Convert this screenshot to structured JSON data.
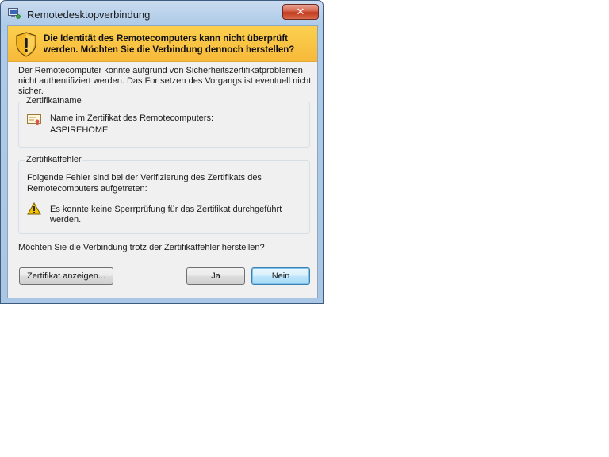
{
  "window": {
    "title": "Remotedesktopverbindung",
    "close_symbol": "✕",
    "icons": {
      "app": "remote-desktop-icon",
      "close": "close-icon"
    }
  },
  "banner": {
    "text": "Die Identität des Remotecomputers kann nicht überprüft werden. Möchten Sie die Verbindung dennoch herstellen?",
    "icon": "security-shield-warning-icon",
    "color": "#f8c246"
  },
  "description": "Der Remotecomputer konnte aufgrund von Sicherheitszertifikatproblemen nicht authentifiziert werden. Das Fortsetzen des Vorgangs ist eventuell nicht sicher.",
  "cert_name_group": {
    "title": "Zertifikatname",
    "label": "Name im Zertifikat des Remotecomputers:",
    "value": "ASPIREHOME",
    "icon": "certificate-icon"
  },
  "cert_error_group": {
    "title": "Zertifikatfehler",
    "intro": "Folgende Fehler sind bei der Verifizierung des Zertifikats des Remotecomputers aufgetreten:",
    "error": "Es konnte keine Sperrprüfung für das Zertifikat durchgeführt werden.",
    "icon": "warning-icon"
  },
  "question": "Möchten Sie die Verbindung trotz der Zertifikatfehler herstellen?",
  "buttons": {
    "view_cert": "Zertifikat anzeigen...",
    "yes": "Ja",
    "no": "Nein"
  }
}
